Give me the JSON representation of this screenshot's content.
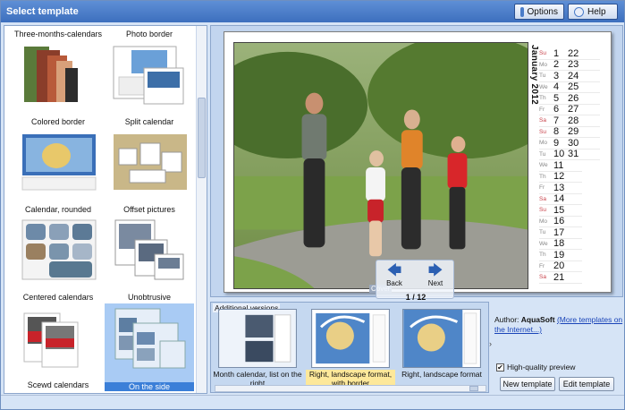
{
  "window": {
    "title": "Select template"
  },
  "toolbar": {
    "options_label": "Options",
    "help_label": "Help"
  },
  "templates": [
    {
      "name": "Three-months-calendars"
    },
    {
      "name": "Photo border"
    },
    {
      "name": "Colored border"
    },
    {
      "name": "Split calendar"
    },
    {
      "name": "Calendar, rounded"
    },
    {
      "name": "Offset pictures"
    },
    {
      "name": "Centered calendars"
    },
    {
      "name": "Unobtrusive"
    },
    {
      "name": "Scewd calendars"
    },
    {
      "name": "On the side",
      "selected": true
    }
  ],
  "preview": {
    "month_title": "January 2012",
    "days_left": [
      [
        "Su",
        "1"
      ],
      [
        "Mo",
        "2"
      ],
      [
        "Tu",
        "3"
      ],
      [
        "We",
        "4"
      ],
      [
        "Th",
        "5"
      ],
      [
        "Fr",
        "6"
      ],
      [
        "Sa",
        "7"
      ],
      [
        "Su",
        "8"
      ],
      [
        "Mo",
        "9"
      ],
      [
        "Tu",
        "10"
      ],
      [
        "We",
        "11"
      ],
      [
        "Th",
        "12"
      ],
      [
        "Fr",
        "13"
      ],
      [
        "Sa",
        "14"
      ],
      [
        "Su",
        "15"
      ],
      [
        "Mo",
        "16"
      ],
      [
        "Tu",
        "17"
      ],
      [
        "We",
        "18"
      ],
      [
        "Th",
        "19"
      ],
      [
        "Fr",
        "20"
      ],
      [
        "Sa",
        "21"
      ]
    ],
    "days_right": [
      "22",
      "23",
      "24",
      "25",
      "26",
      "27",
      "28",
      "29",
      "30",
      "31"
    ],
    "nav": {
      "back_label": "Back",
      "next_label": "Next",
      "page_count": "1 / 12",
      "page_link": "Cover"
    }
  },
  "additional": {
    "header": "Additional versions",
    "versions": [
      {
        "label": "Month calendar, list on the right"
      },
      {
        "label": "Right, landscape format, with border",
        "active": true
      },
      {
        "label": "Right, landscape format"
      }
    ]
  },
  "info": {
    "author_prefix": "Author: ",
    "author_name": "AquaSoft",
    "more_link": "(More templates on the Internet...)",
    "hq_label": "High-quality preview",
    "hq_checked": "✔"
  },
  "buttons": {
    "new_template": "New template",
    "edit_template": "Edit template"
  },
  "colors": {
    "accent": "#3d6fbe",
    "weekend": "#c7424a",
    "highlight": "#fde89a"
  }
}
